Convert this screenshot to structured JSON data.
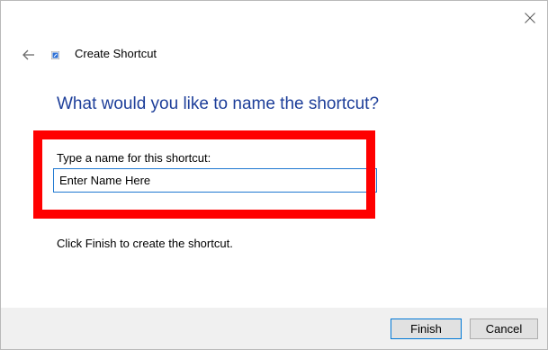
{
  "window": {
    "title": "Create Shortcut"
  },
  "icons": {
    "close": "close-icon",
    "back": "back-arrow-icon",
    "wizard": "shortcut-icon"
  },
  "page": {
    "heading": "What would you like to name the shortcut?",
    "field_label": "Type a name for this shortcut:",
    "name_value": "Enter Name Here",
    "hint": "Click Finish to create the shortcut."
  },
  "buttons": {
    "finish": "Finish",
    "cancel": "Cancel"
  },
  "colors": {
    "heading": "#1e3f9a",
    "highlight": "#ff0000",
    "input_border": "#1f78d1",
    "footer_bg": "#f0f0f0"
  }
}
